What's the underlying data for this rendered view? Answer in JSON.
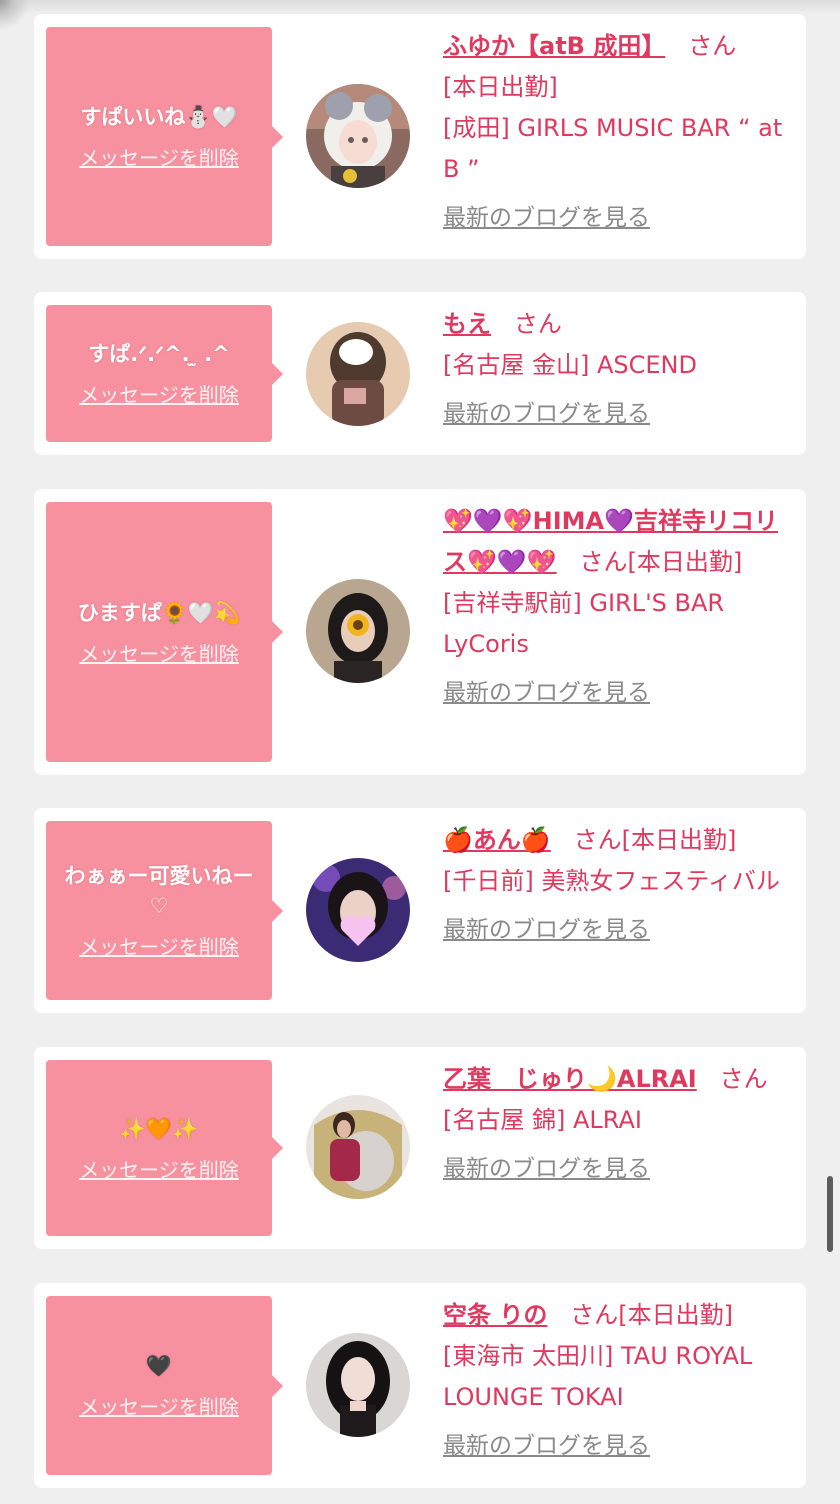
{
  "delete_label": "メッセージを削除",
  "blog_label": "最新のブログを見る",
  "san_label": "さん",
  "items": [
    {
      "message": "すぱいいね⛄🤍",
      "name": "ふゆか【atB 成田】",
      "status": "[本日出勤]",
      "shop": "[成田] GIRLS MUSIC BAR “ at B ”"
    },
    {
      "message": "すぱ.ᐟ.ᐟ^. ̫ .^",
      "name": "もえ",
      "status": "",
      "shop": "[名古屋 金山] ASCEND"
    },
    {
      "message": "ひますぱ🌻🤍💫",
      "name": "💖💜💖HIMA💜吉祥寺リコリス💖💜💖",
      "status": "[本日出勤]",
      "shop": "[吉祥寺駅前] GIRL'S BAR LyCoris"
    },
    {
      "message": "わぁぁー可愛いねー♡",
      "name": "🍎あん🍎",
      "status": "[本日出勤]",
      "shop": "[千日前] 美熟女フェスティバル"
    },
    {
      "message": "✨🧡✨",
      "name": "乙葉　じゅり🌙ALRAI",
      "status": "",
      "shop": "[名古屋 錦] ALRAI"
    },
    {
      "message": "🖤",
      "name": "空条 りの",
      "status": "[本日出勤]",
      "shop": "[東海市 太田川] TAU ROYAL LOUNGE TOKAI"
    }
  ],
  "colors": {
    "accent": "#e0395f",
    "bubble": "#f8919f",
    "background": "#efefef",
    "link_gray": "#8a8a8a"
  }
}
